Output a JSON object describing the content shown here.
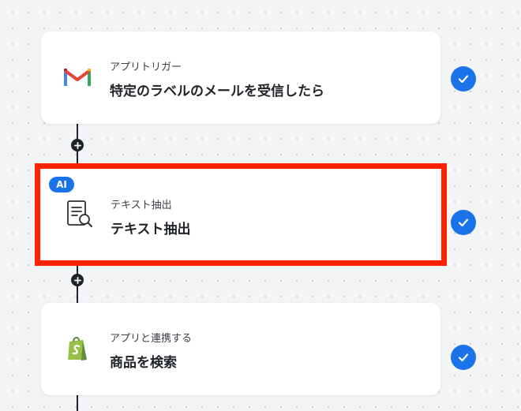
{
  "steps": [
    {
      "badge": "",
      "subtitle": "アプリトリガー",
      "title": "特定のラベルのメールを受信したら",
      "icon": "gmail-icon",
      "status": "completed"
    },
    {
      "badge": "AI",
      "subtitle": "テキスト抽出",
      "title": "テキスト抽出",
      "icon": "document-search-icon",
      "status": "completed"
    },
    {
      "badge": "",
      "subtitle": "アプリと連携する",
      "title": "商品を検索",
      "icon": "shopify-icon",
      "status": "completed"
    }
  ],
  "colors": {
    "accent": "#1a73e8",
    "highlight": "#ff2200",
    "connector": "#1f2328"
  },
  "add_step_icon": "plus-icon"
}
